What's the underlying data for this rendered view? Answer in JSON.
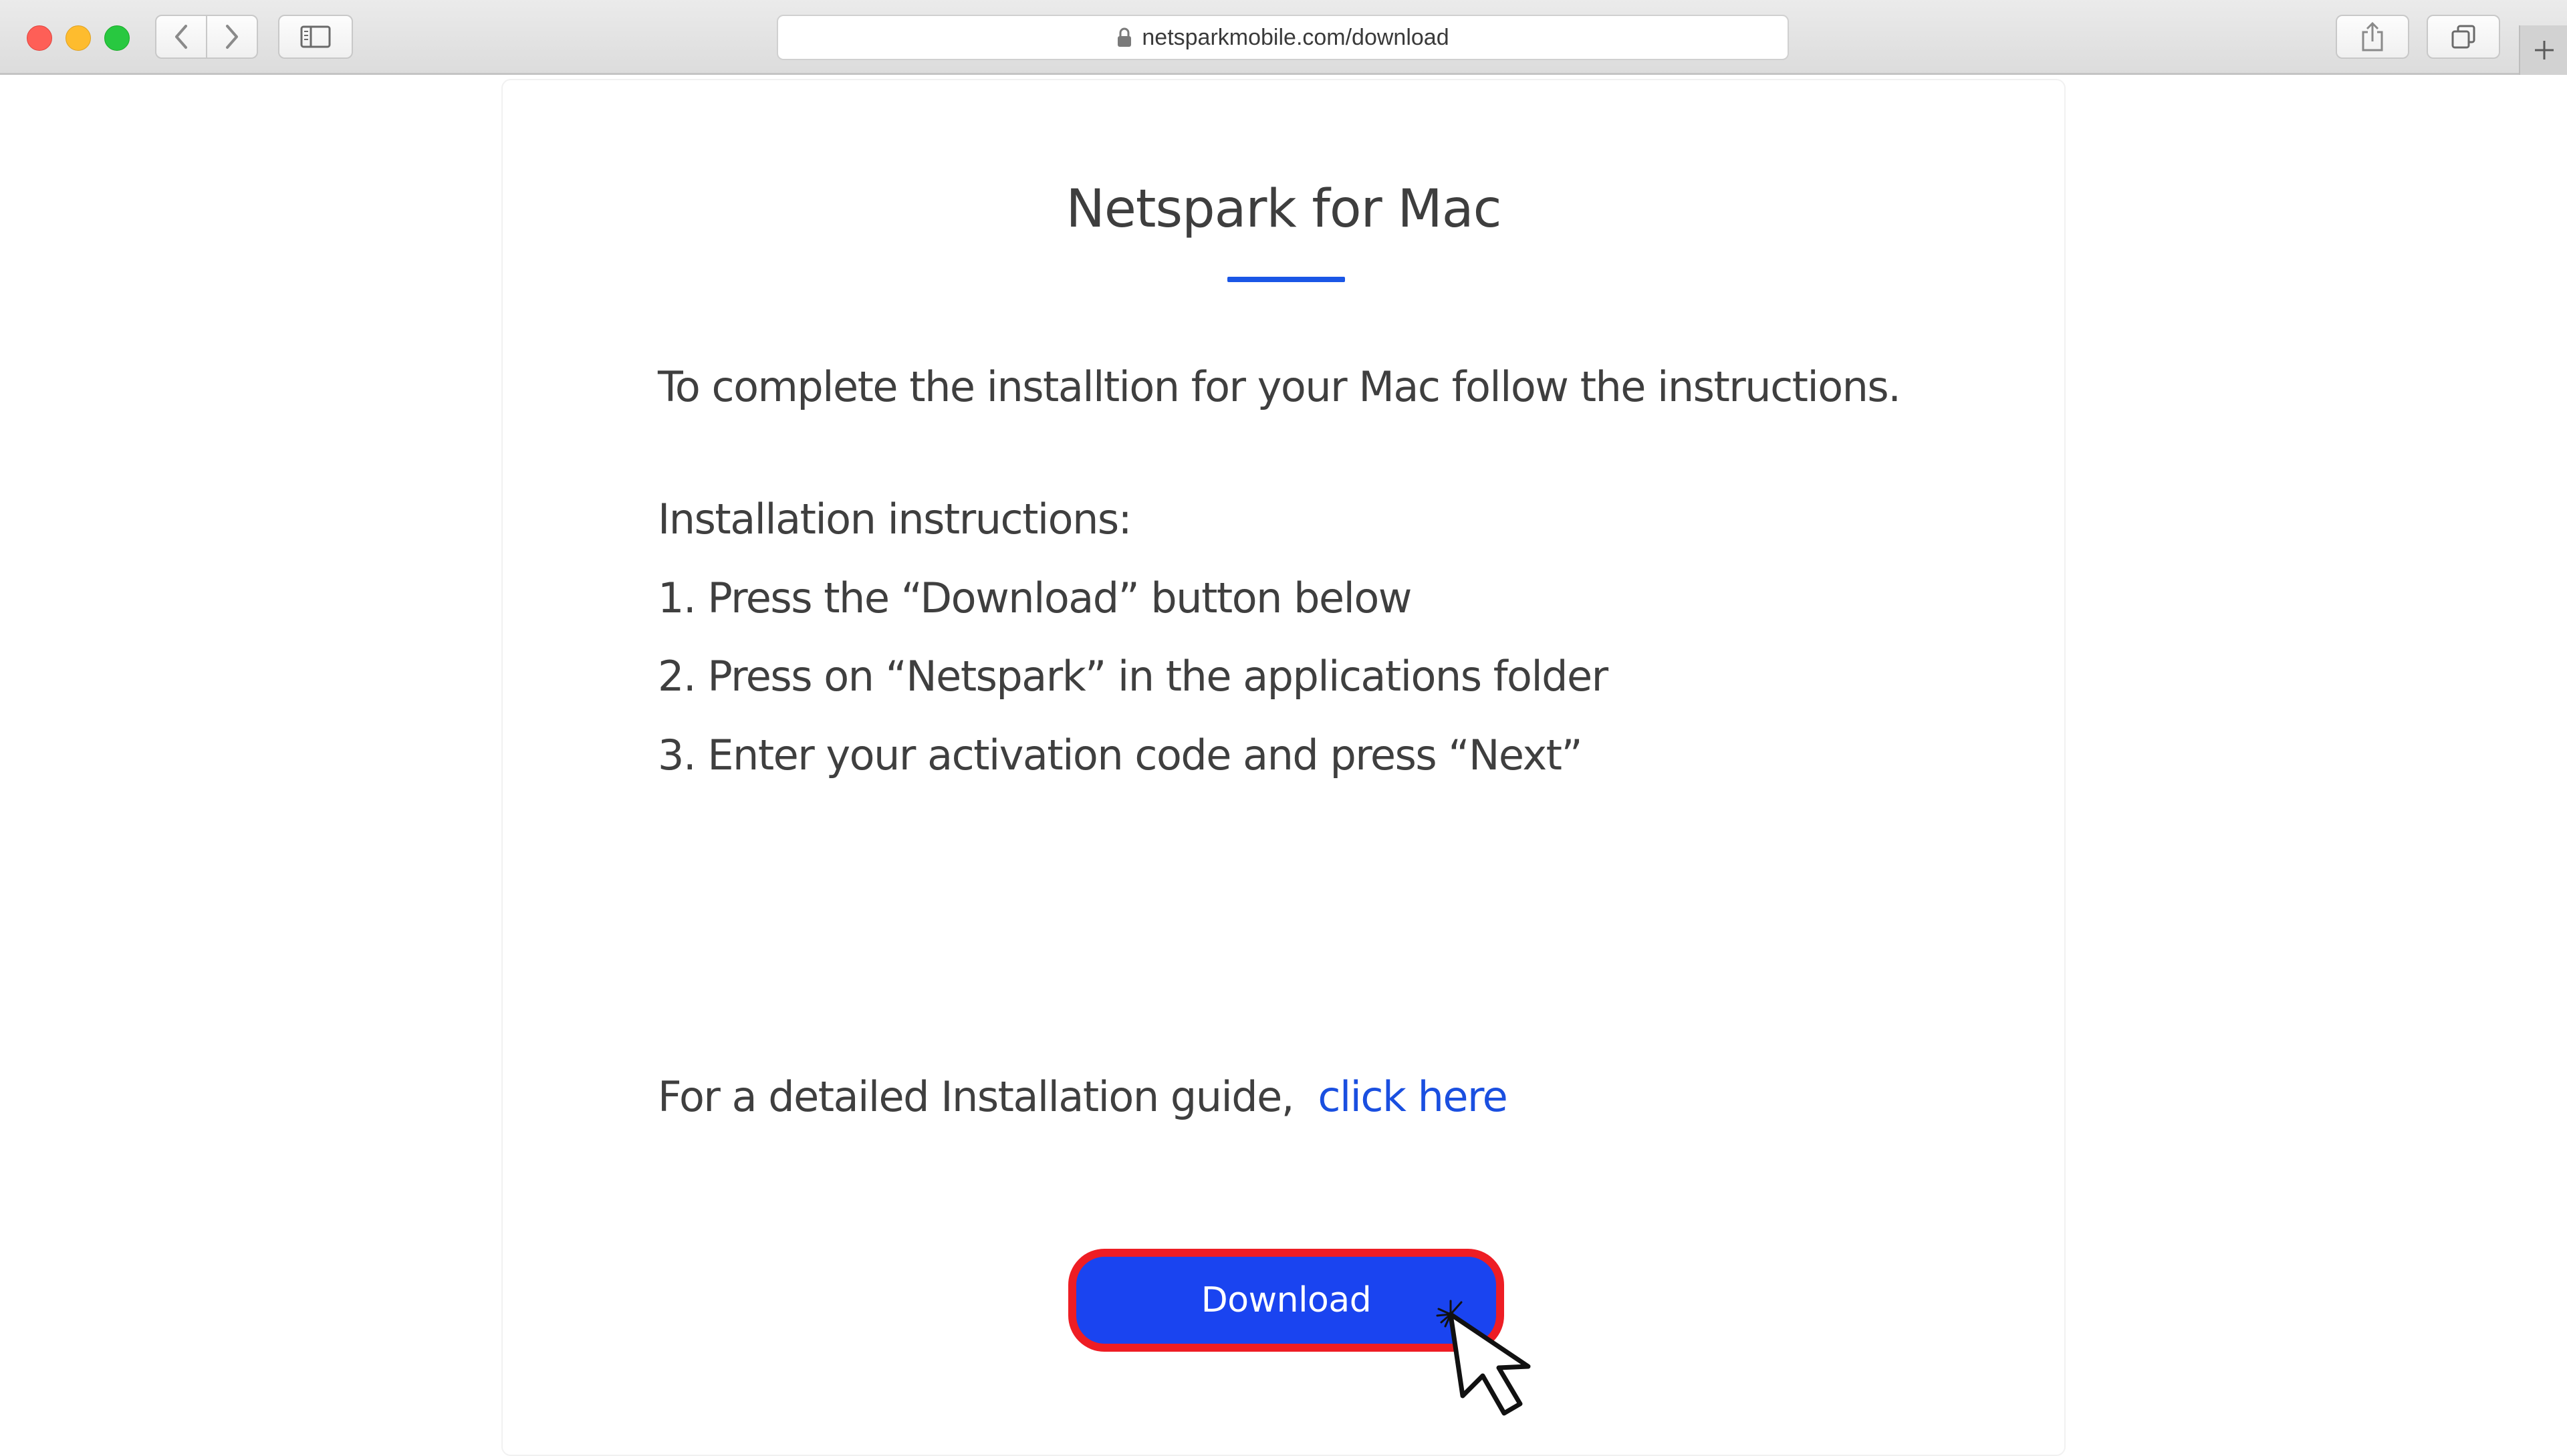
{
  "browser": {
    "url": "netsparkmobile.com/download",
    "icons": {
      "back": "chevron-left-icon",
      "forward": "chevron-right-icon",
      "sidebar": "sidebar-icon",
      "lock": "lock-icon",
      "share": "share-icon",
      "tabs": "tabs-icon",
      "new_tab": "plus-icon"
    }
  },
  "page": {
    "title": "Netspark for Mac",
    "intro": "To complete the installtion for your Mac follow the instructions.",
    "instructions_heading": "Installation instructions:",
    "steps": [
      "1. Press the “Download” button below",
      "2. Press on “Netspark” in the applications folder",
      "3. Enter your activation code and press “Next”"
    ],
    "guide_text": "For a detailed Installation guide,",
    "guide_link": "click here",
    "download_label": "Download"
  },
  "colors": {
    "accent": "#1a56e6",
    "button_fill": "#1a44f0",
    "button_outline": "#ee1d24",
    "link": "#1a4fe0"
  }
}
